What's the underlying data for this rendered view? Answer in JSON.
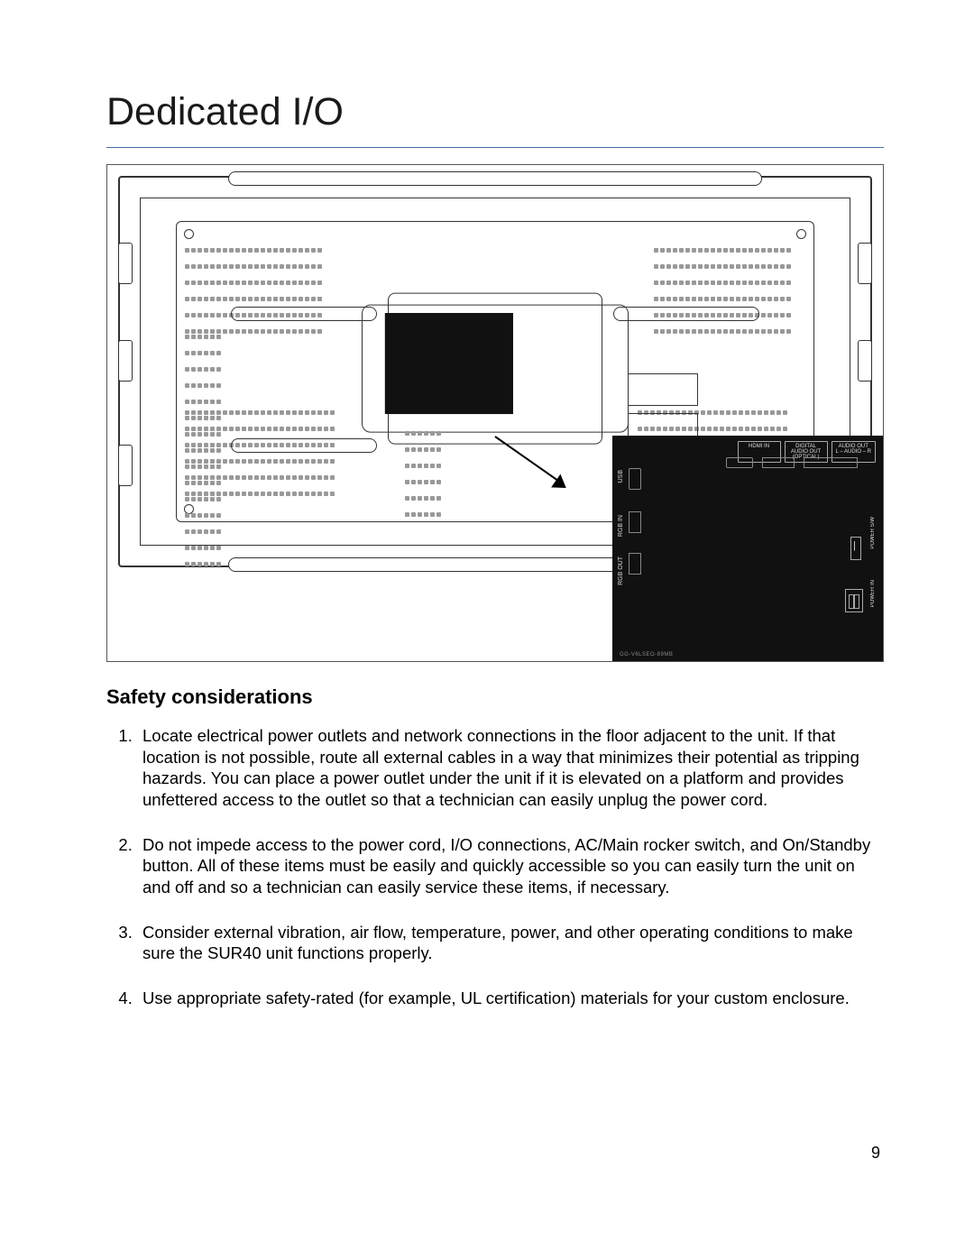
{
  "title": "Dedicated I/O",
  "figure_ports": {
    "hdmi": "HDMI IN",
    "optical": "DIGITAL\nAUDIO OUT\n(OPTICAL)",
    "audio": "AUDIO OUT\nL – AUDIO – R",
    "usb": "USB",
    "rgb": "RGB IN",
    "rgbout": "RGB OUT",
    "power_sw": "POWER S/W",
    "power_in": "POWER IN",
    "footer": "GG-V6LSEO-89MB"
  },
  "section_heading": "Safety considerations",
  "safety_items": [
    "Locate electrical power outlets and network connections in the floor adjacent to the unit. If that location is not possible, route all external cables in a way that minimizes their potential as tripping hazards. You can place a power outlet under the unit if it is elevated on a platform and provides unfettered access to the outlet so that a technician can easily unplug the power cord.",
    "Do not impede access to the power cord, I/O connections, AC/Main rocker switch, and On/Standby button. All of these items must be easily and quickly accessible so you can easily turn the unit on and off and so a technician can easily service these items, if necessary.",
    "Consider external vibration, air flow, temperature, power, and other operating conditions to make sure the SUR40 unit functions properly.",
    "Use appropriate safety-rated (for example, UL certification) materials for your custom enclosure."
  ],
  "page_number": "9"
}
